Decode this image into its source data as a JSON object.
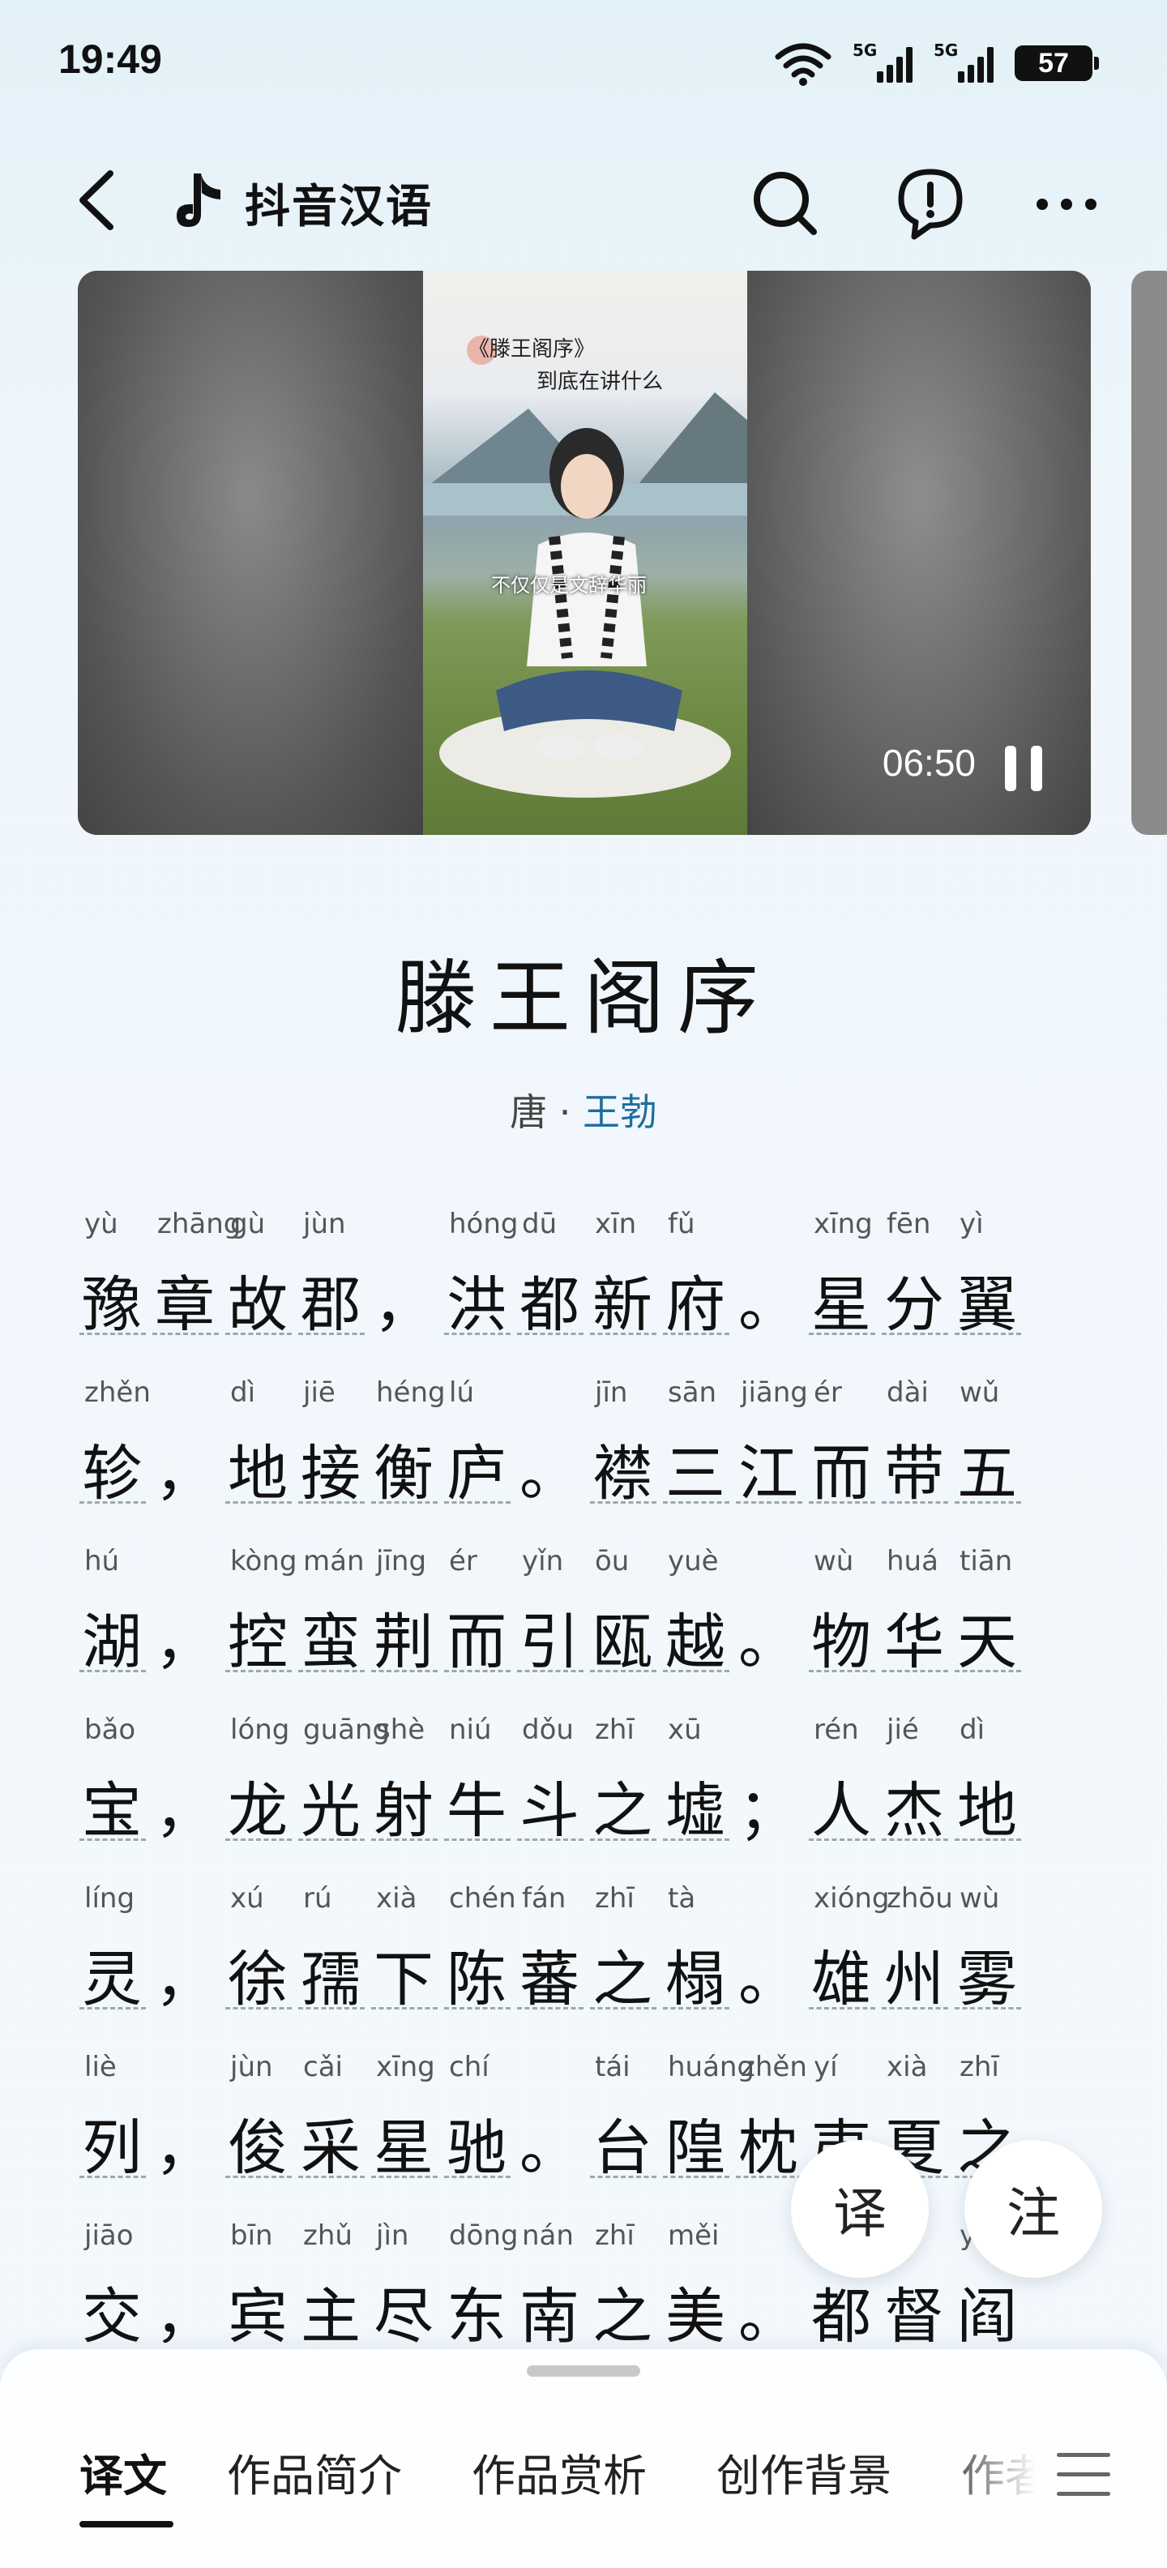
{
  "status_bar": {
    "time": "19:49",
    "network_1": "5G",
    "network_2": "5G",
    "battery": "57",
    "icons": [
      "wifi-icon",
      "signal-icon",
      "signal-icon",
      "battery-icon"
    ]
  },
  "nav": {
    "title": "抖音汉语",
    "icons": [
      "back-icon",
      "douyin-logo-icon",
      "search-icon",
      "report-icon",
      "more-icon"
    ]
  },
  "video": {
    "title_line1": "《滕王阁序》",
    "title_line2": "到底在讲什么",
    "caption": "不仅仅是文辞华丽",
    "time": "06:50"
  },
  "poem": {
    "title": "滕王阁序",
    "dynasty": "唐",
    "separator": "·",
    "author": "王勃",
    "lines": [
      {
        "chars": [
          "豫",
          "章",
          "故",
          "郡",
          "，",
          "洪",
          "都",
          "新",
          "府",
          "。",
          "星",
          "分",
          "翼"
        ],
        "pinyin": [
          "yù",
          "zhāng",
          "gù",
          "jùn",
          "",
          "hóng",
          "dū",
          "xīn",
          "fǔ",
          "",
          "xīng",
          "fēn",
          "yì"
        ]
      },
      {
        "chars": [
          "轸",
          "，",
          "地",
          "接",
          "衡",
          "庐",
          "。",
          "襟",
          "三",
          "江",
          "而",
          "带",
          "五"
        ],
        "pinyin": [
          "zhěn",
          "",
          "dì",
          "jiē",
          "héng",
          "lú",
          "",
          "jīn",
          "sān",
          "jiāng",
          "ér",
          "dài",
          "wǔ"
        ]
      },
      {
        "chars": [
          "湖",
          "，",
          "控",
          "蛮",
          "荆",
          "而",
          "引",
          "瓯",
          "越",
          "。",
          "物",
          "华",
          "天"
        ],
        "pinyin": [
          "hú",
          "",
          "kòng",
          "mán",
          "jīng",
          "ér",
          "yǐn",
          "ōu",
          "yuè",
          "",
          "wù",
          "huá",
          "tiān"
        ]
      },
      {
        "chars": [
          "宝",
          "，",
          "龙",
          "光",
          "射",
          "牛",
          "斗",
          "之",
          "墟",
          "；",
          "人",
          "杰",
          "地"
        ],
        "pinyin": [
          "bǎo",
          "",
          "lóng",
          "guāng",
          "shè",
          "niú",
          "dǒu",
          "zhī",
          "xū",
          "",
          "rén",
          "jié",
          "dì"
        ]
      },
      {
        "chars": [
          "灵",
          "，",
          "徐",
          "孺",
          "下",
          "陈",
          "蕃",
          "之",
          "榻",
          "。",
          "雄",
          "州",
          "雾"
        ],
        "pinyin": [
          "líng",
          "",
          "xú",
          "rú",
          "xià",
          "chén",
          "fán",
          "zhī",
          "tà",
          "",
          "xióng",
          "zhōu",
          "wù"
        ]
      },
      {
        "chars": [
          "列",
          "，",
          "俊",
          "采",
          "星",
          "驰",
          "。",
          "台",
          "隍",
          "枕",
          "夷",
          "夏",
          "之"
        ],
        "pinyin": [
          "liè",
          "",
          "jùn",
          "cǎi",
          "xīng",
          "chí",
          "",
          "tái",
          "huáng",
          "zhěn",
          "yí",
          "xià",
          "zhī"
        ]
      },
      {
        "chars": [
          "交",
          "，",
          "宾",
          "主",
          "尽",
          "东",
          "南",
          "之",
          "美",
          "。",
          "都",
          "督",
          "阎"
        ],
        "pinyin": [
          "jiāo",
          "",
          "bīn",
          "zhǔ",
          "jìn",
          "dōng",
          "nán",
          "zhī",
          "měi",
          "",
          "",
          "",
          "yá"
        ]
      }
    ]
  },
  "fabs": {
    "translate": "译",
    "annotate": "注"
  },
  "tabs": [
    "译文",
    "作品简介",
    "作品赏析",
    "创作背景",
    "作者"
  ],
  "colors": {
    "author_link": "#1d6e9c",
    "background": "#eef6fb"
  }
}
